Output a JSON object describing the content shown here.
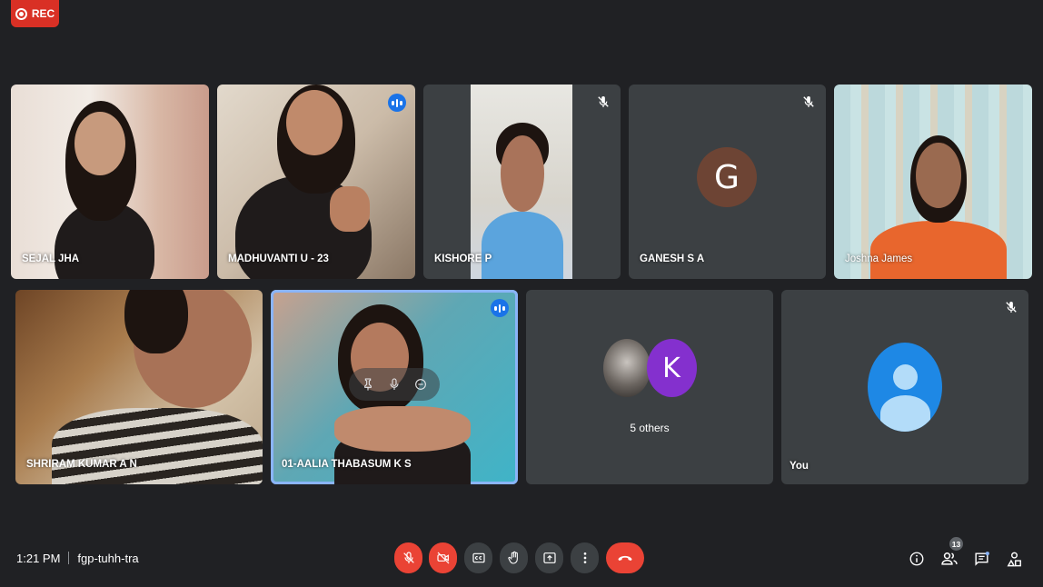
{
  "recording": {
    "label": "REC",
    "color": "#d93025"
  },
  "participants": [
    {
      "name": "SEJAL JHA",
      "muted": false,
      "speaking": false
    },
    {
      "name": "MADHUVANTI U - 23",
      "muted": false,
      "speaking": true
    },
    {
      "name": "KISHORE P",
      "muted": true,
      "speaking": false
    },
    {
      "name": "GANESH S A",
      "muted": true,
      "speaking": false,
      "avatar_letter": "G"
    },
    {
      "name": "Joshna James",
      "muted": false,
      "speaking": false
    },
    {
      "name": "SHRIRAM KUMAR A N",
      "muted": false,
      "speaking": false
    },
    {
      "name": "01-AALIA THABASUM K S",
      "muted": false,
      "speaking": true,
      "pinned_view": true
    },
    {
      "name": "5 others",
      "avatar_letter": "K"
    },
    {
      "name": "You",
      "muted": true
    }
  ],
  "meeting": {
    "time": "1:21 PM",
    "code": "fgp-tuhh-tra"
  },
  "people_count": "13",
  "colors": {
    "background": "#202124",
    "tile": "#3c4043",
    "danger": "#ea4335",
    "speaking": "#1a73e8",
    "active_border": "#8ab4f8"
  }
}
